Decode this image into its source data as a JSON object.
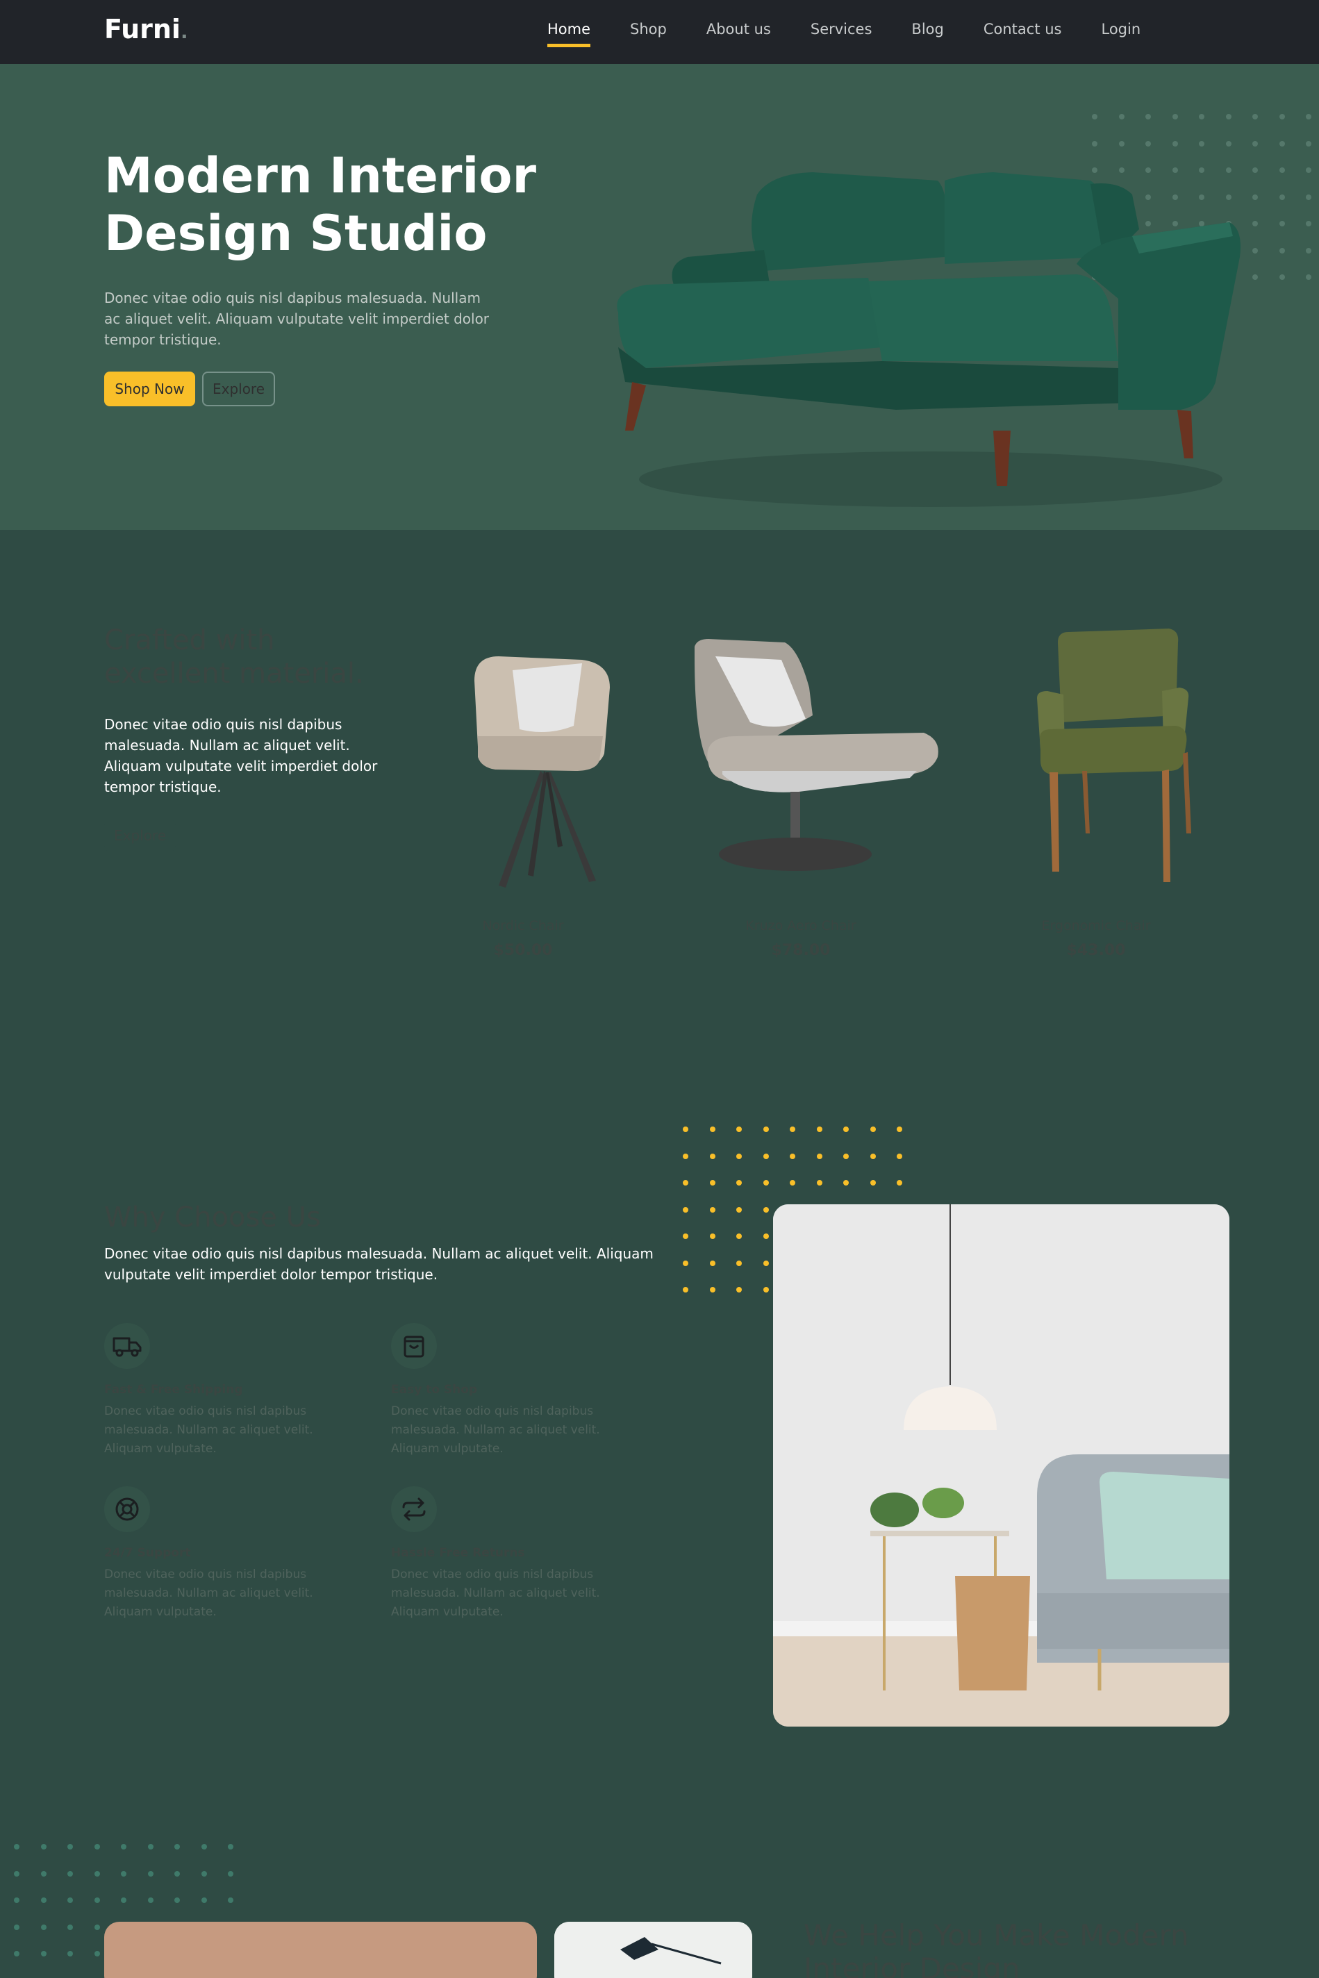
{
  "brand": {
    "name": "Furni",
    "dot": "."
  },
  "nav": {
    "items": [
      {
        "label": "Home",
        "active": true
      },
      {
        "label": "Shop",
        "active": false
      },
      {
        "label": "About us",
        "active": false
      },
      {
        "label": "Services",
        "active": false
      },
      {
        "label": "Blog",
        "active": false
      },
      {
        "label": "Contact us",
        "active": false
      },
      {
        "label": "Login",
        "active": false
      }
    ]
  },
  "hero": {
    "title_line1": "Modern Interior",
    "title_line2": "Design Studio",
    "description": "Donec vitae odio quis nisl dapibus malesuada. Nullam ac aliquet velit. Aliquam vulputate velit imperdiet dolor tempor tristique.",
    "shop_label": "Shop Now",
    "explore_label": "Explore"
  },
  "products_section": {
    "title": "Crafted with excellent material.",
    "description": "Donec vitae odio quis nisl dapibus malesuada. Nullam ac aliquet velit. Aliquam vulputate velit imperdiet dolor tempor tristique.",
    "explore_label": "Explore",
    "products": [
      {
        "name": "Nordic Chair",
        "price": "$50.00"
      },
      {
        "name": "Kruzo Aero Chair",
        "price": "$78.00"
      },
      {
        "name": "Ergonomic Chair",
        "price": "$43.00"
      }
    ]
  },
  "why": {
    "title": "Why Choose Us",
    "description": "Donec vitae odio quis nisl dapibus malesuada. Nullam ac aliquet velit. Aliquam vulputate velit imperdiet dolor tempor tristique.",
    "features": [
      {
        "title": "Fast & Free Shipping",
        "icon": "truck-icon",
        "description": "Donec vitae odio quis nisl dapibus malesuada. Nullam ac aliquet velit. Aliquam vulputate."
      },
      {
        "title": "Easy to Shop",
        "icon": "bag-icon",
        "description": "Donec vitae odio quis nisl dapibus malesuada. Nullam ac aliquet velit. Aliquam vulputate."
      },
      {
        "title": "24/7 Support",
        "icon": "support-icon",
        "description": "Donec vitae odio quis nisl dapibus malesuada. Nullam ac aliquet velit. Aliquam vulputate."
      },
      {
        "title": "Hassle Free Returns",
        "icon": "returns-icon",
        "description": "Donec vitae odio quis nisl dapibus malesuada. Nullam ac aliquet velit. Aliquam vulputate."
      }
    ]
  },
  "help": {
    "title": "We Help You Make Modern Interior Design"
  },
  "colors": {
    "nav_bg": "#212429",
    "hero_bg": "#3b5d50",
    "page_bg": "#2f4b44",
    "accent": "#f9bf29"
  }
}
